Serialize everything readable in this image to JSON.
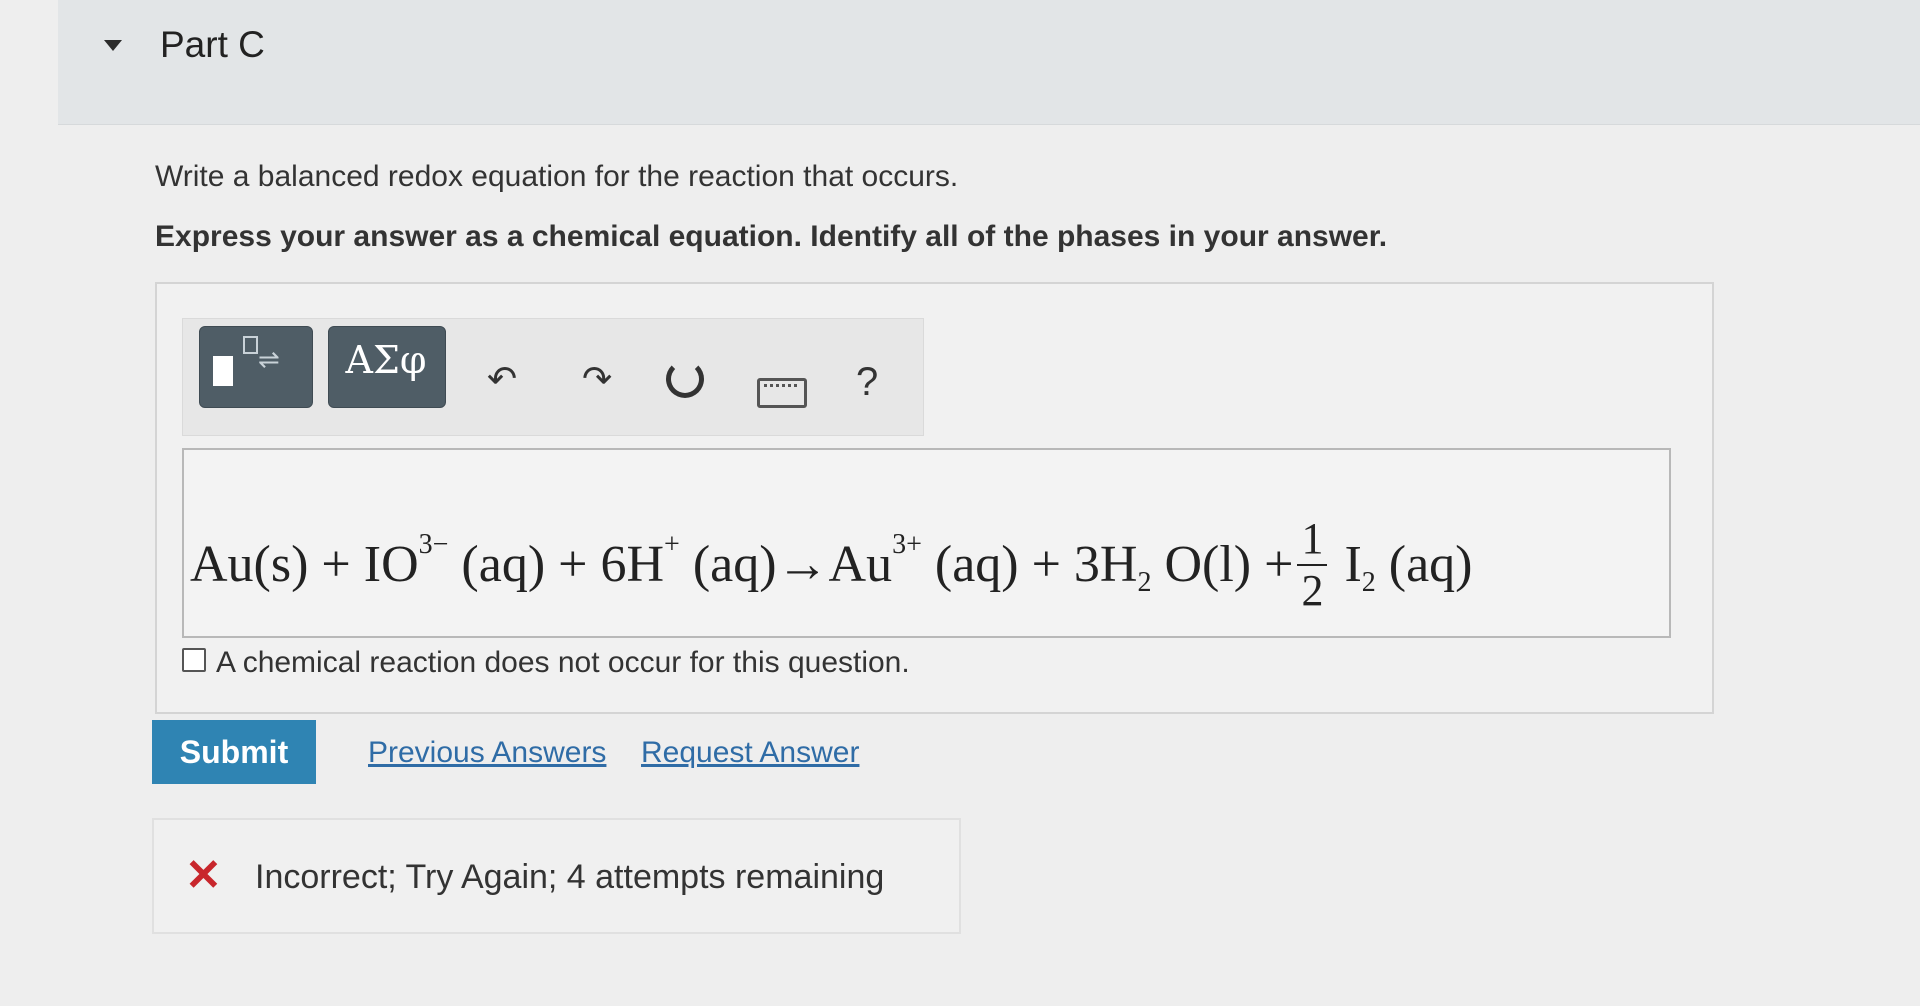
{
  "part": {
    "title": "Part C"
  },
  "question": {
    "prompt": "Write a balanced redox equation for the reaction that occurs.",
    "instruction": "Express your answer as a chemical equation. Identify all of the phases in your answer."
  },
  "toolbar": {
    "greek_label": "ΑΣφ",
    "help_label": "?"
  },
  "equation": {
    "t1": "Au(s) + IO",
    "s1": "3−",
    "t2": " (aq) + 6H",
    "s2": "+",
    "t3": " (aq)→Au",
    "s3": "3+",
    "t4": " (aq) + 3H",
    "b1": "2",
    "t5": " O(l) +",
    "num": "1",
    "den": "2",
    "t6": " I",
    "b2": "2",
    "t7": " (aq)"
  },
  "no_reaction": {
    "label": "A chemical reaction does not occur for this question."
  },
  "actions": {
    "submit_label": "Submit",
    "previous_answers_label": "Previous Answers",
    "request_answer_label": "Request Answer"
  },
  "feedback": {
    "message": "Incorrect; Try Again; 4 attempts remaining"
  },
  "colors": {
    "submit": "#2f84b3",
    "link": "#2f6ca6",
    "error": "#c8262c",
    "tool_dark": "#4f5d66"
  }
}
